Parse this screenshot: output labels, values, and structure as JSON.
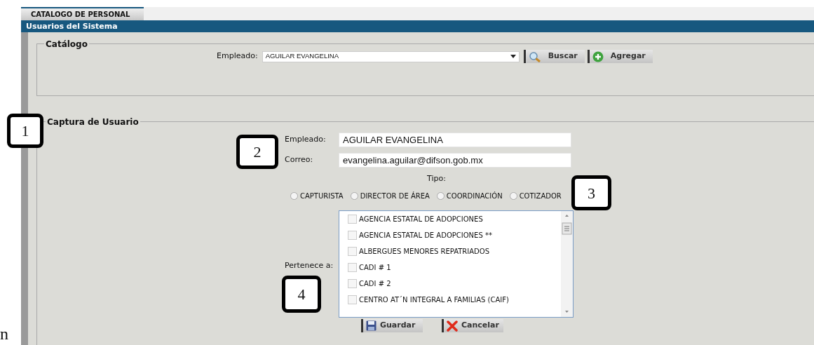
{
  "document_fragment": "n",
  "tab": {
    "label": "CATALOGO DE PERSONAL",
    "selected": true
  },
  "header": {
    "title": "Usuarios del Sistema"
  },
  "catalog": {
    "legend": "Catálogo",
    "label": "Empleado:",
    "value": "AGUILAR EVANGELINA",
    "buttons": [
      {
        "label": "Buscar",
        "kind": "search"
      },
      {
        "label": "Agregar",
        "kind": "add"
      }
    ]
  },
  "capture": {
    "legend": "Captura de Usuario",
    "employee_label": "Empleado:",
    "employee_value": "AGUILAR EVANGELINA",
    "email_label": "Correo:",
    "email_value": "evangelina.aguilar@difson.gob.mx",
    "tipo_label": "Tipo:",
    "tipo_options": [
      {
        "label": "CAPTURISTA",
        "selected": false
      },
      {
        "label": "DIRECTOR DE ÁREA",
        "selected": false
      },
      {
        "label": "COORDINACIÓN",
        "selected": false
      },
      {
        "label": "COTIZADOR",
        "selected": false
      }
    ],
    "pertenece_label": "Pertenece a:",
    "units": [
      {
        "label": "AGENCIA ESTATAL DE ADOPCIONES",
        "checked": false
      },
      {
        "label": "AGENCIA ESTATAL DE ADOPCIONES **",
        "checked": false
      },
      {
        "label": "ALBERGUES MENORES REPATRIADOS",
        "checked": false
      },
      {
        "label": "CADI # 1",
        "checked": false
      },
      {
        "label": "CADI # 2",
        "checked": false
      },
      {
        "label": "CENTRO AT´N INTEGRAL A FAMILIAS (CAIF)",
        "checked": false
      }
    ],
    "buttons": [
      {
        "label": "Guardar",
        "kind": "save"
      },
      {
        "label": "Cancelar",
        "kind": "cancel"
      }
    ]
  },
  "callouts": [
    {
      "label": "1"
    },
    {
      "label": "2"
    },
    {
      "label": "3"
    },
    {
      "label": "4"
    }
  ]
}
